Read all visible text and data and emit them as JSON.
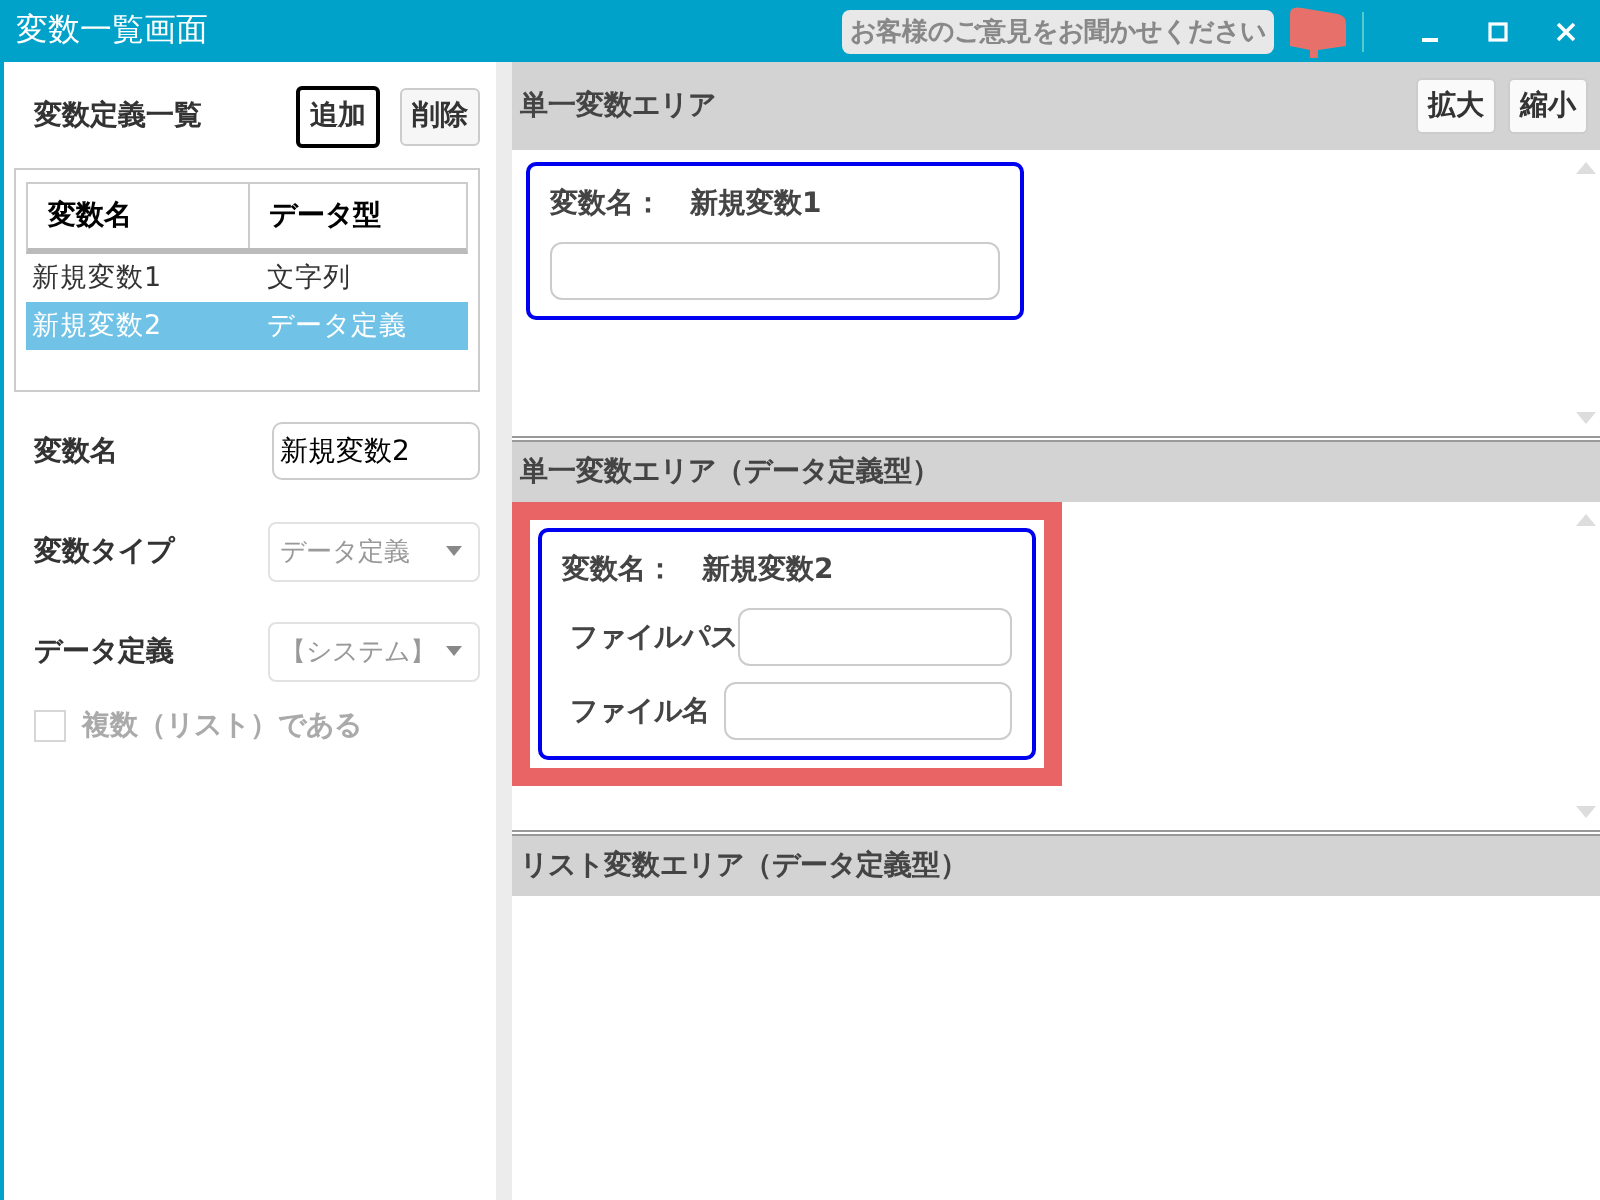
{
  "window": {
    "title": "変数一覧画面",
    "feedback": "お客様のご意見をお聞かせください"
  },
  "variable_list": {
    "title": "変数定義一覧",
    "buttons": [
      {
        "label": "追加",
        "focused": true
      },
      {
        "label": "削除",
        "focused": false
      }
    ],
    "columns": [
      "変数名",
      "データ型"
    ],
    "rows": [
      {
        "cells": [
          "新規変数1",
          "文字列"
        ],
        "selected": false
      },
      {
        "cells": [
          "新規変数2",
          "データ定義"
        ],
        "selected": true
      }
    ]
  },
  "properties": [
    {
      "kind": "text",
      "label": "変数名",
      "value": "新規変数2"
    },
    {
      "kind": "select",
      "label": "変数タイプ",
      "value": "データ定義"
    },
    {
      "kind": "select",
      "label": "データ定義",
      "value": "【システム】"
    }
  ],
  "checkbox": {
    "label": "複数（リスト）である",
    "checked": false,
    "disabled": true
  },
  "sections": [
    {
      "title": "単一変数エリア",
      "buttons": [
        "拡大",
        "縮小"
      ],
      "cards": [
        {
          "name_label": "変数名：",
          "name": "新規変数1",
          "highlighted": false,
          "fields": [
            {
              "kind": "plain"
            }
          ]
        }
      ]
    },
    {
      "title": "単一変数エリア（データ定義型）",
      "cards": [
        {
          "name_label": "変数名：",
          "name": "新規変数2",
          "highlighted": true,
          "fields": [
            {
              "kind": "labeled",
              "label": "ファイルパス"
            },
            {
              "kind": "labeled",
              "label": "ファイル名"
            }
          ]
        }
      ]
    },
    {
      "title": "リスト変数エリア（データ定義型）"
    }
  ]
}
